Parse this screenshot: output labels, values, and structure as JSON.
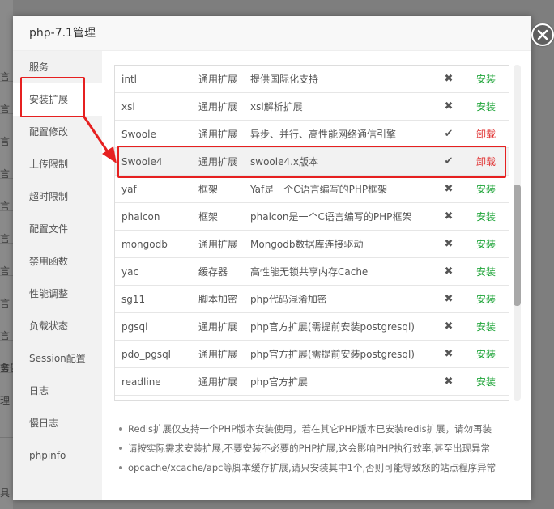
{
  "background": {
    "side_chars": [
      "言",
      "言",
      "言",
      "言",
      "言",
      "言",
      "言",
      "言",
      "言",
      "言",
      "言",
      "务健",
      "理",
      "具"
    ]
  },
  "dialog": {
    "title": "php-7.1管理",
    "close_icon": "close-icon"
  },
  "sidebar": {
    "items": [
      {
        "label": "服务"
      },
      {
        "label": "安装扩展",
        "active": true
      },
      {
        "label": "配置修改"
      },
      {
        "label": "上传限制"
      },
      {
        "label": "超时限制"
      },
      {
        "label": "配置文件"
      },
      {
        "label": "禁用函数"
      },
      {
        "label": "性能调整"
      },
      {
        "label": "负载状态"
      },
      {
        "label": "Session配置"
      },
      {
        "label": "日志"
      },
      {
        "label": "慢日志"
      },
      {
        "label": "phpinfo"
      }
    ]
  },
  "extensions": [
    {
      "name": "intl",
      "type": "通用扩展",
      "desc": "提供国际化支持",
      "installed": false,
      "action": "安装"
    },
    {
      "name": "xsl",
      "type": "通用扩展",
      "desc": "xsl解析扩展",
      "installed": false,
      "action": "安装"
    },
    {
      "name": "Swoole",
      "type": "通用扩展",
      "desc": "异步、并行、高性能网络通信引擎",
      "installed": true,
      "action": "卸载"
    },
    {
      "name": "Swoole4",
      "type": "通用扩展",
      "desc": "swoole4.x版本",
      "installed": true,
      "action": "卸载",
      "highlighted": true
    },
    {
      "name": "yaf",
      "type": "框架",
      "desc": "Yaf是一个C语言编写的PHP框架",
      "installed": false,
      "action": "安装"
    },
    {
      "name": "phalcon",
      "type": "框架",
      "desc": "phalcon是一个C语言编写的PHP框架",
      "installed": false,
      "action": "安装"
    },
    {
      "name": "mongodb",
      "type": "通用扩展",
      "desc": "Mongodb数据库连接驱动",
      "installed": false,
      "action": "安装"
    },
    {
      "name": "yac",
      "type": "缓存器",
      "desc": "高性能无锁共享内存Cache",
      "installed": false,
      "action": "安装"
    },
    {
      "name": "sg11",
      "type": "脚本加密",
      "desc": "php代码混淆加密",
      "installed": false,
      "action": "安装"
    },
    {
      "name": "pgsql",
      "type": "通用扩展",
      "desc": "php官方扩展(需提前安装postgresql)",
      "installed": false,
      "action": "安装"
    },
    {
      "name": "pdo_pgsql",
      "type": "通用扩展",
      "desc": "php官方扩展(需提前安装postgresql)",
      "installed": false,
      "action": "安装"
    },
    {
      "name": "readline",
      "type": "通用扩展",
      "desc": "php官方扩展",
      "installed": false,
      "action": "安装"
    }
  ],
  "status_icons": {
    "installed": "✔",
    "not_installed": "✖"
  },
  "notes": [
    "Redis扩展仅支持一个PHP版本安装使用，若在其它PHP版本已安装redis扩展，请勿再装",
    "请按实际需求安装扩展,不要安装不必要的PHP扩展,这会影响PHP执行效率,甚至出现异常",
    "opcache/xcache/apc等脚本缓存扩展,请只安装其中1个,否则可能导致您的站点程序异常"
  ],
  "colors": {
    "install": "#20a53a",
    "uninstall": "#e03030",
    "annotation": "#e62020"
  }
}
